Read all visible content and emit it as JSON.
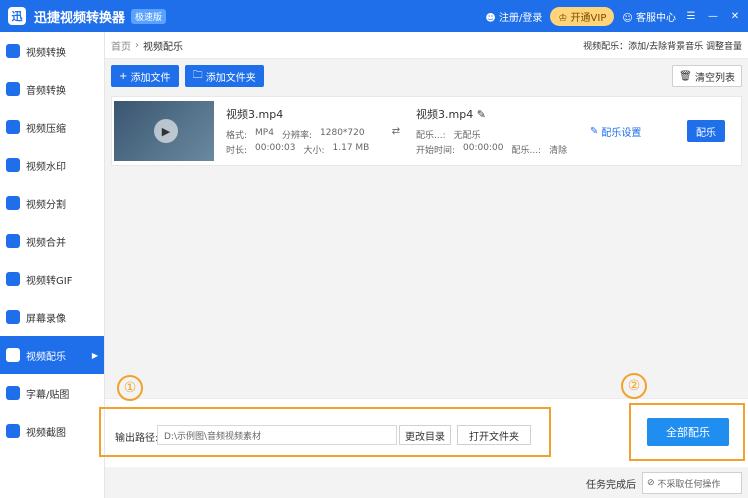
{
  "app": {
    "title": "迅捷视频转换器",
    "badge": "极速版",
    "logo": "迅"
  },
  "titlebar": {
    "login": "注册/登录",
    "vip": "开通VIP",
    "service": "客服中心"
  },
  "sidebar": {
    "items": [
      {
        "label": "视频转换",
        "icon": "video-convert-icon"
      },
      {
        "label": "音频转换",
        "icon": "audio-convert-icon"
      },
      {
        "label": "视频压缩",
        "icon": "video-compress-icon"
      },
      {
        "label": "视频水印",
        "icon": "watermark-icon"
      },
      {
        "label": "视频分割",
        "icon": "split-icon"
      },
      {
        "label": "视频合并",
        "icon": "merge-icon"
      },
      {
        "label": "视频转GIF",
        "icon": "gif-icon"
      },
      {
        "label": "屏幕录像",
        "icon": "screen-record-icon"
      },
      {
        "label": "视频配乐",
        "icon": "music-icon"
      },
      {
        "label": "字幕/贴图",
        "icon": "subtitle-icon"
      },
      {
        "label": "视频截图",
        "icon": "screenshot-icon"
      }
    ]
  },
  "crumb": {
    "home": "首页",
    "current": "视频配乐",
    "right": "视频配乐：添加/去除背景音乐 调整音量"
  },
  "toolbar": {
    "add_file": "添加文件",
    "add_folder": "添加文件夹",
    "clear": "清空列表"
  },
  "file": {
    "name": "视频3.mp4",
    "format_label": "格式:",
    "format": "MP4",
    "resolution_label": "分辨率:",
    "resolution": "1280*720",
    "duration_label": "时长:",
    "duration": "00:00:03",
    "size_label": "大小:",
    "size": "1.17 MB"
  },
  "output": {
    "name": "视频3.mp4",
    "music_label": "配乐...:",
    "music": "无配乐",
    "start_label": "开始时间:",
    "start": "00:00:00",
    "music2_label": "配乐...:",
    "clear": "清除"
  },
  "row": {
    "settings": "配乐设置",
    "action": "配乐"
  },
  "bottom": {
    "out_label": "输出路径:",
    "path": "D:\\示例图\\音频视频素材",
    "change_dir": "更改目录",
    "open_folder": "打开文件夹",
    "all": "全部配乐",
    "num1": "①",
    "num2": "②"
  },
  "footer": {
    "label": "任务完成后",
    "select": "不采取任何操作"
  }
}
